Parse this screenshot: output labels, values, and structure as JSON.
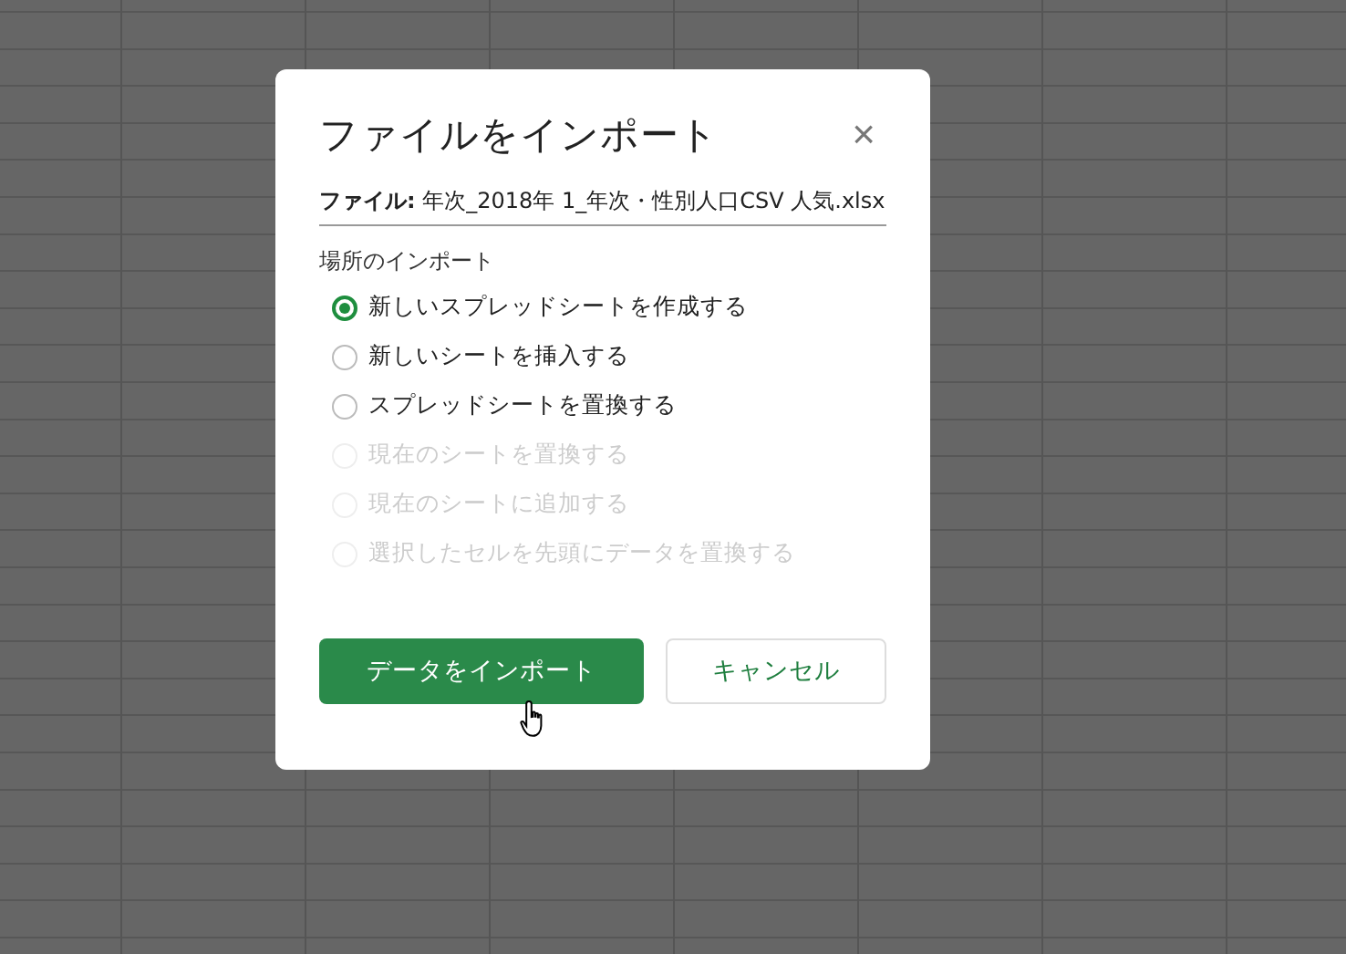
{
  "dialog": {
    "title": "ファイルをインポート",
    "close": "×",
    "file": "**ファイル:** 年次_2018年 1_年次・性別人口CSV 人気.xlsx",
    "section_label": "場所のインポート",
    "options": [
      {
        "label": "新しいスプレッドシートを作成する",
        "selected": true,
        "disabled": false
      },
      {
        "label": "新しいシートを挿入する",
        "selected": false,
        "disabled": false
      },
      {
        "label": "スプレッドシートを置換する",
        "selected": false,
        "disabled": false
      },
      {
        "label": "現在のシートを置換する",
        "selected": false,
        "disabled": true
      },
      {
        "label": "現在のシートに追加する",
        "selected": false,
        "disabled": true
      },
      {
        "label": "選択したセルを先頭にデータを置換する",
        "selected": false,
        "disabled": true
      }
    ],
    "buttons": [
      {
        "label": "データをインポート",
        "kind": "primary"
      },
      {
        "label": "キャンセル",
        "kind": "secondary"
      }
    ]
  }
}
